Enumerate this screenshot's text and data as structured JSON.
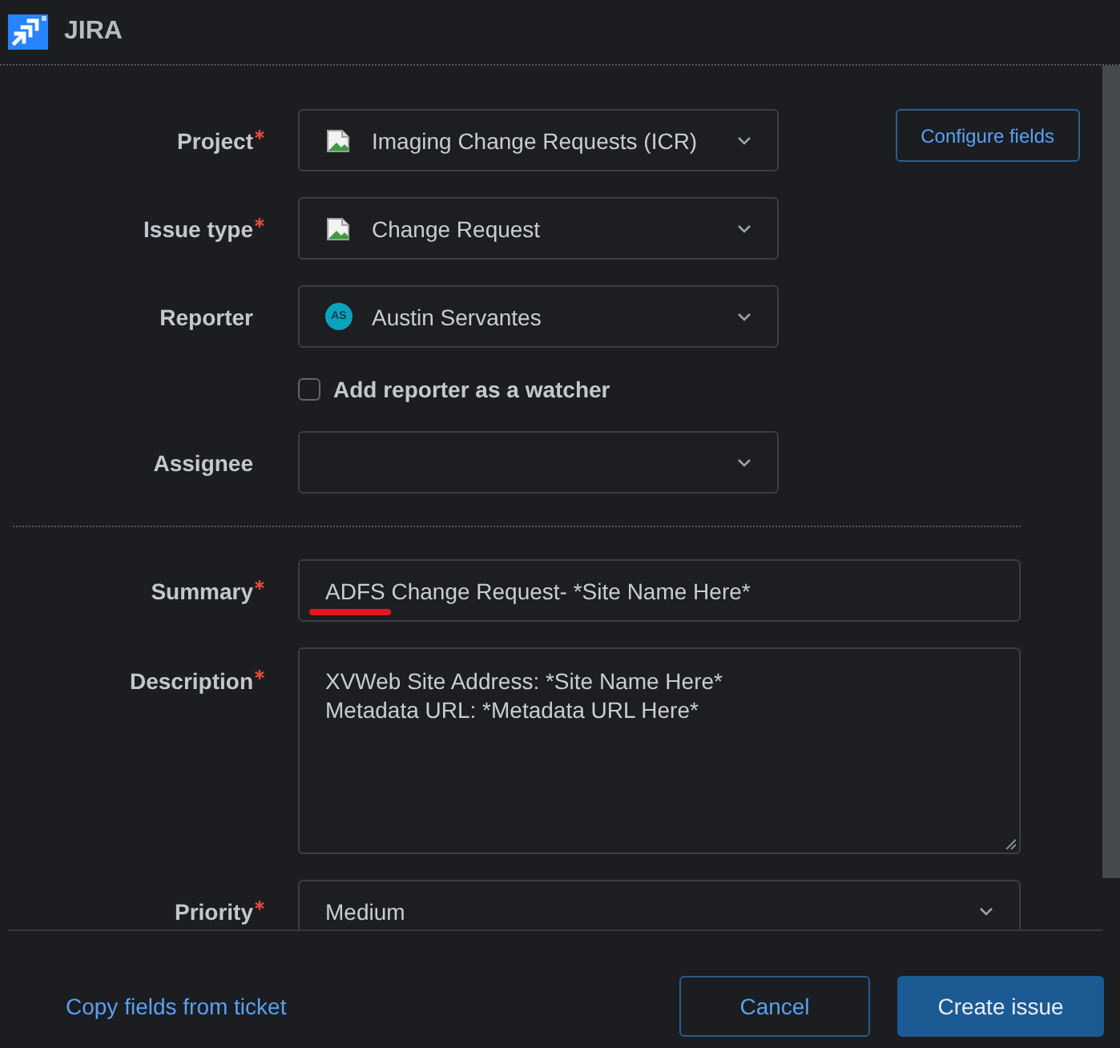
{
  "window": {
    "title": "JIRA"
  },
  "form": {
    "configure_button": "Configure fields",
    "sections": [
      {
        "fields": [
          {
            "kind": "select",
            "label": "Project",
            "required": true,
            "value": "Imaging Change Requests (ICR)",
            "has_icon": true
          },
          {
            "kind": "select",
            "label": "Issue type",
            "required": true,
            "value": "Change Request",
            "has_icon": true
          },
          {
            "kind": "select",
            "label": "Reporter",
            "required": false,
            "value": "Austin Servantes",
            "avatar": "AS"
          },
          {
            "kind": "checkbox",
            "label": "Add reporter as a watcher",
            "checked": false
          },
          {
            "kind": "select",
            "label": "Assignee",
            "required": false
          }
        ]
      },
      {
        "fields": [
          {
            "kind": "text",
            "label": "Summary",
            "required": true,
            "value": "ADFS Change Request- *Site Name Here*",
            "annotated": true
          },
          {
            "kind": "textarea",
            "label": "Description",
            "required": true,
            "value": "XVWeb Site Address: *Site Name Here*\nMetadata URL: *Metadata URL Here*"
          },
          {
            "kind": "select",
            "label": "Priority",
            "required": true,
            "value": "Medium"
          }
        ]
      }
    ]
  },
  "footer": {
    "link": "Copy fields from ticket",
    "buttons": [
      {
        "label": "Cancel",
        "kind": "secondary"
      },
      {
        "label": "Create issue",
        "kind": "primary"
      }
    ]
  }
}
